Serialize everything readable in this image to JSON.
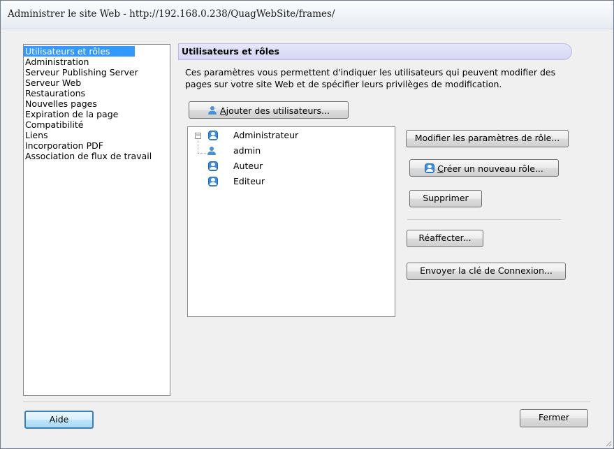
{
  "window": {
    "title": "Administrer le site Web - http://192.168.0.238/QuagWebSite/frames/"
  },
  "nav": {
    "items": [
      {
        "label": "Utilisateurs et rôles",
        "selected": true
      },
      {
        "label": "Administration"
      },
      {
        "label": "Serveur Publishing Server"
      },
      {
        "label": "Serveur Web"
      },
      {
        "label": "Restaurations"
      },
      {
        "label": "Nouvelles pages"
      },
      {
        "label": "Expiration de la page"
      },
      {
        "label": "Compatibilité"
      },
      {
        "label": "Liens"
      },
      {
        "label": "Incorporation PDF"
      },
      {
        "label": "Association de flux de travail"
      }
    ]
  },
  "section": {
    "title": "Utilisateurs et rôles",
    "description": "Ces paramètres vous permettent d'indiquer les utilisateurs qui peuvent modifier des pages sur votre site Web et de spécifier leurs privilèges de modification."
  },
  "buttons": {
    "add_users": {
      "mnemonic": "A",
      "rest": "jouter des utilisateurs..."
    },
    "modify_role": "Modifier les paramètres de rôle...",
    "create_role": {
      "mnemonic": "C",
      "rest": "réer un nouveau rôle..."
    },
    "delete": "Supprimer",
    "reassign": "Réaffecter...",
    "send_key": "Envoyer la clé de Connexion...",
    "help": "Aide",
    "close": "Fermer"
  },
  "tree": {
    "nodes": [
      {
        "label": "Administrateur",
        "type": "role",
        "expanded": true,
        "expander": "−"
      },
      {
        "label": "admin",
        "type": "user"
      },
      {
        "label": "Auteur",
        "type": "role"
      },
      {
        "label": "Editeur",
        "type": "role"
      }
    ]
  },
  "icons": {
    "role": "role-icon",
    "user": "user-icon"
  },
  "colors": {
    "selection": "#3399ff",
    "header_bg": "#dcdef7",
    "icon_blue": "#3a8fe3"
  }
}
